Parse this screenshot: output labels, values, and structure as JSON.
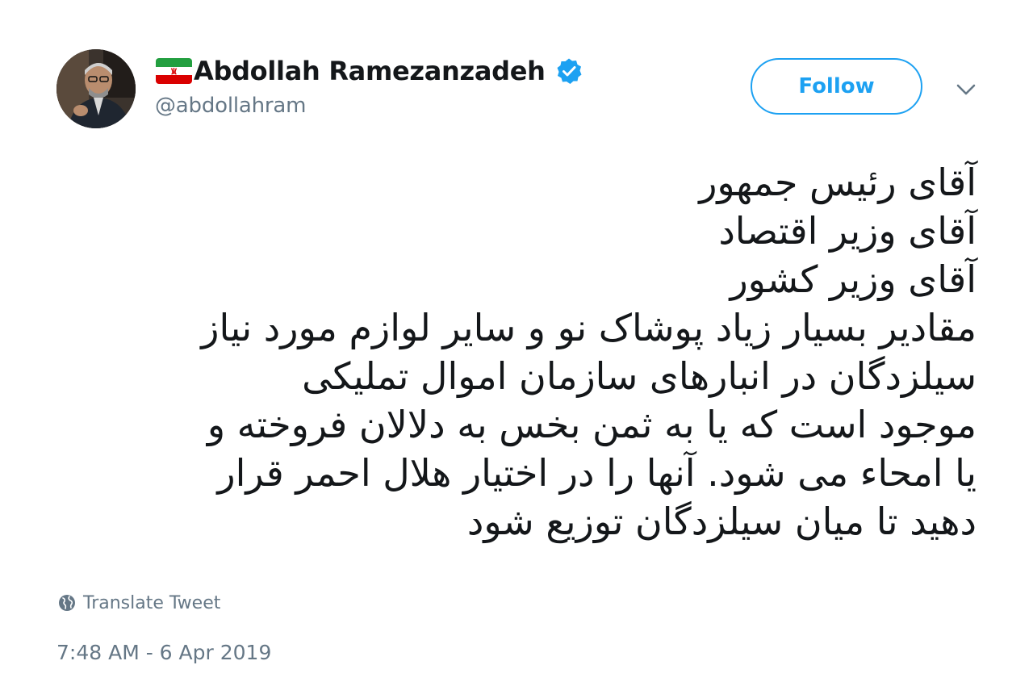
{
  "user": {
    "display_name": "Abdollah Ramezanzadeh",
    "handle": "@abdollahram",
    "flag_icon": "iran-flag-emoji",
    "verified_icon": "verified-badge-icon",
    "avatar": "profile-photo"
  },
  "actions": {
    "follow_label": "Follow",
    "menu_icon": "chevron-down-icon"
  },
  "tweet": {
    "lines": [
      "آقای رئیس جمهور",
      "آقای وزیر اقتصاد",
      "آقای وزیر کشور",
      "مقادیر بسیار زیاد پوشاک نو و سایر لوازم مورد نیاز",
      "سیلزدگان در انبارهای سازمان اموال تملیکی",
      "موجود است که یا به ثمن بخس به دلالان فروخته و",
      "یا امحاء می شود. آنها را در اختیار هلال احمر قرار",
      "دهید تا میان سیلزدگان توزیع شود"
    ]
  },
  "translate": {
    "label": "Translate Tweet",
    "icon": "globe-icon"
  },
  "timestamp": "7:48 AM - 6 Apr 2019",
  "colors": {
    "accent": "#1da1f2",
    "text": "#14171a",
    "muted": "#657786",
    "background": "#ffffff"
  }
}
